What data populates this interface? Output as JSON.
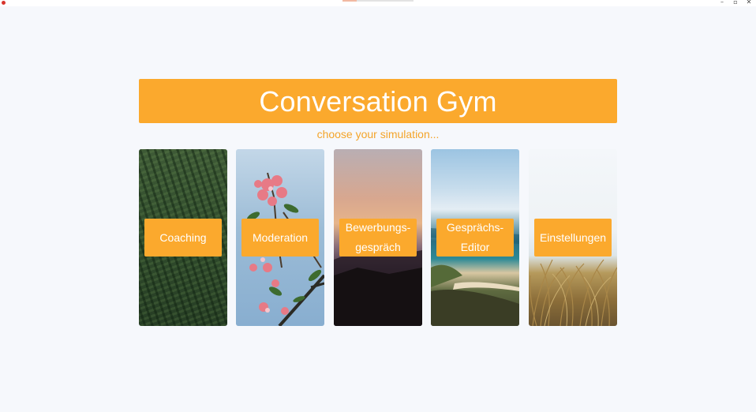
{
  "app": {
    "title": "Conversation Gym",
    "subtitle": "choose your simulation..."
  },
  "window_controls": {
    "minimize": "–",
    "maximize": "▫",
    "close": "✕"
  },
  "cards": [
    {
      "label": "Coaching",
      "image": "tea-field-photo"
    },
    {
      "label": "Moderation",
      "image": "pink-flowers-photo"
    },
    {
      "label": "Bewerbungs-\ngespräch",
      "image": "sunset-mountain-photo"
    },
    {
      "label": "Gesprächs-\nEditor",
      "image": "coastline-photo"
    },
    {
      "label": "Einstellungen",
      "image": "dune-grass-photo"
    }
  ],
  "colors": {
    "accent": "#fba92d",
    "background": "#f6f8fc",
    "label_text": "#ffffff",
    "subtitle_text": "#f4a42a"
  }
}
